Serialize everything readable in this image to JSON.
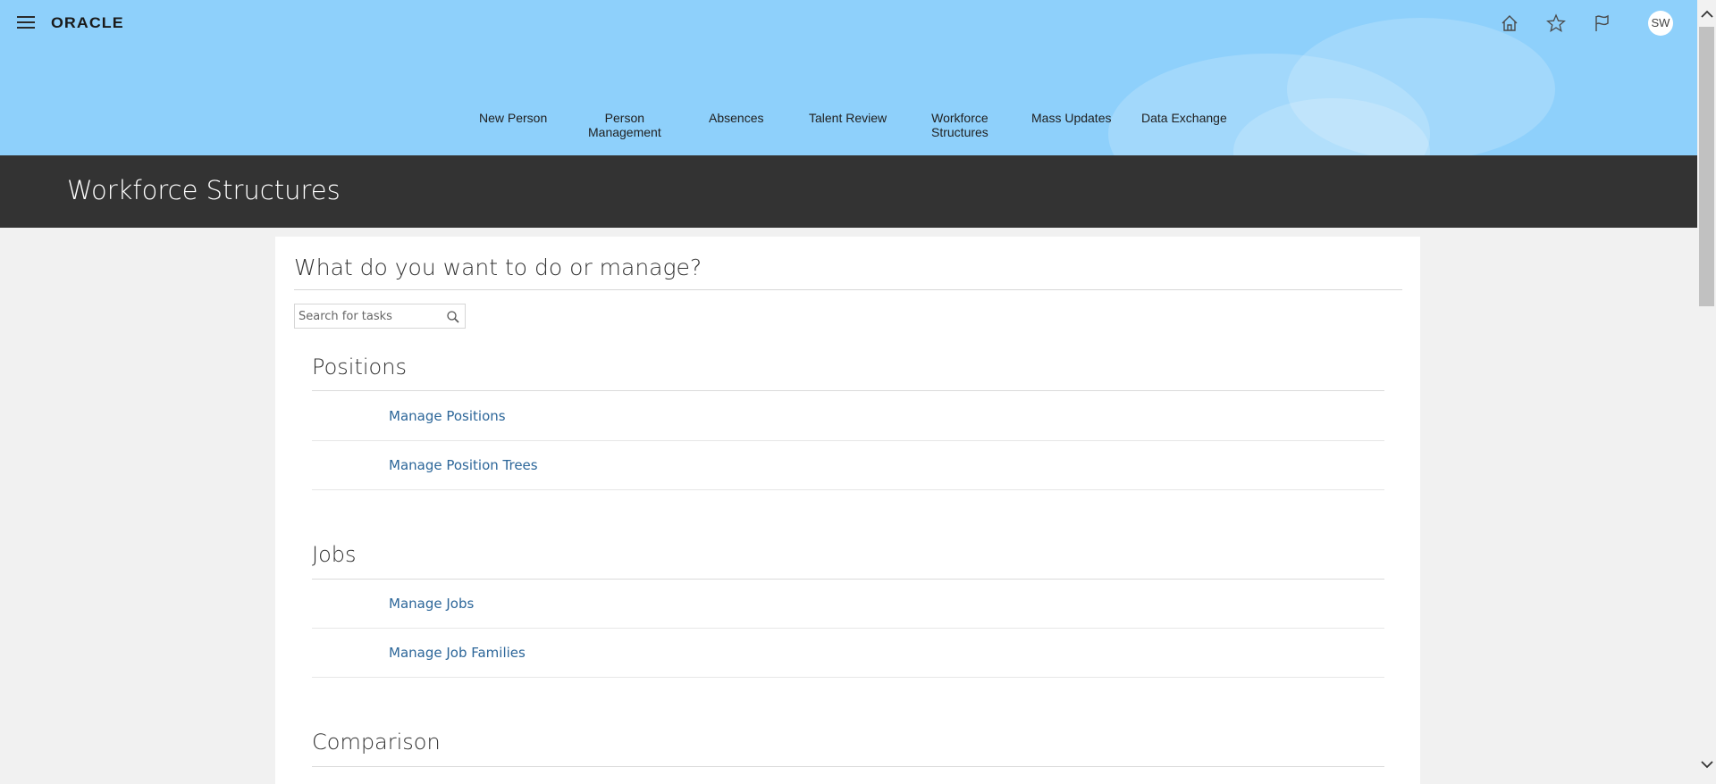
{
  "header": {
    "logo_text": "ORACLE",
    "avatar_initials": "SW",
    "icons": [
      "menu-icon",
      "home-icon",
      "star-icon",
      "flag-icon"
    ],
    "background_color": "#8ed0fb"
  },
  "nav": {
    "items": [
      {
        "label": "New Person"
      },
      {
        "label": "Person\nManagement"
      },
      {
        "label": "Absences"
      },
      {
        "label": "Talent Review"
      },
      {
        "label": "Workforce\nStructures"
      },
      {
        "label": "Mass Updates"
      },
      {
        "label": "Data Exchange"
      }
    ],
    "active_index": 3
  },
  "page": {
    "title": "Workforce Structures",
    "titlebar_color": "#333333"
  },
  "main": {
    "heading": "What do you want to do or manage?",
    "search": {
      "placeholder": "Search for tasks",
      "value": ""
    },
    "sections": [
      {
        "title": "Positions",
        "tasks": [
          "Manage Positions",
          "Manage Position Trees"
        ]
      },
      {
        "title": "Jobs",
        "tasks": [
          "Manage Jobs",
          "Manage Job Families"
        ]
      },
      {
        "title": "Comparison",
        "tasks": []
      }
    ],
    "link_color": "#2c6699"
  }
}
